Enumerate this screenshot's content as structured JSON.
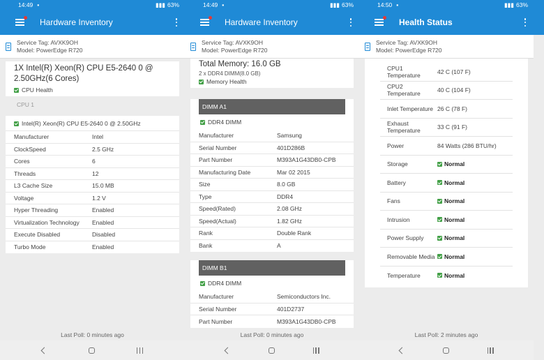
{
  "colors": {
    "accent": "#1f8ad6",
    "ok": "#43a047",
    "section_header": "#616161"
  },
  "icons": {
    "menu": "hamburger-menu-icon",
    "overflow": "kebab-menu-icon",
    "server": "server-icon",
    "check": "check-icon",
    "back": "back-icon",
    "home": "home-icon",
    "recent": "recent-apps-icon"
  },
  "screens": [
    {
      "status": {
        "time": "14:49",
        "battery": "63%"
      },
      "title": "Hardware Inventory",
      "device": {
        "service_tag": "Service Tag: AVXK9OH",
        "model": "Model: PowerEdge R720"
      },
      "summary": {
        "line1": "1X Intel(R) Xeon(R) CPU E5-2640 0 @",
        "line2": "2.50GHz(6 Cores)",
        "health": "CPU Health"
      },
      "section_label": "CPU 1",
      "cpu_name": "Intel(R) Xeon(R) CPU E5-2640 0 @ 2.50GHz",
      "specs": [
        {
          "key": "Manufacturer",
          "value": "Intel"
        },
        {
          "key": "ClockSpeed",
          "value": "2.5 GHz"
        },
        {
          "key": "Cores",
          "value": "6"
        },
        {
          "key": "Threads",
          "value": "12"
        },
        {
          "key": "L3 Cache Size",
          "value": "15.0 MB"
        },
        {
          "key": "Voltage",
          "value": "1.2 V"
        },
        {
          "key": "Hyper Threading",
          "value": "Enabled"
        },
        {
          "key": "Virtualization Technology",
          "value": "Enabled"
        },
        {
          "key": "Execute Disabled",
          "value": "Disabled"
        },
        {
          "key": "Turbo Mode",
          "value": "Enabled"
        }
      ],
      "last_poll": "Last Poll: 0 minutes ago"
    },
    {
      "status": {
        "time": "14:49",
        "battery": "63%"
      },
      "title": "Hardware Inventory",
      "device": {
        "service_tag": "Service Tag: AVXK9OH",
        "model": "Model: PowerEdge R720"
      },
      "summary": {
        "line1": "Total Memory: 16.0 GB",
        "line2": "2 x DDR4 DIMM(8.0 GB)",
        "health": "Memory Health"
      },
      "dimm_a1": {
        "header": "DIMM A1",
        "type_label": "DDR4 DIMM",
        "specs": [
          {
            "key": "Manufacturer",
            "value": "Samsung"
          },
          {
            "key": "Serial Number",
            "value": "401D286B"
          },
          {
            "key": "Part Number",
            "value": "M393A1G43DB0-CPB"
          },
          {
            "key": "Manufacturing Date",
            "value": "Mar 02 2015"
          },
          {
            "key": "Size",
            "value": "8.0 GB"
          },
          {
            "key": "Type",
            "value": "DDR4"
          },
          {
            "key": "Speed(Rated)",
            "value": "2.08 GHz"
          },
          {
            "key": "Speed(Actual)",
            "value": "1.82 GHz"
          },
          {
            "key": "Rank",
            "value": "Double Rank"
          },
          {
            "key": "Bank",
            "value": "A"
          }
        ]
      },
      "dimm_b1": {
        "header": "DIMM B1",
        "type_label": "DDR4 DIMM",
        "specs": [
          {
            "key": "Manufacturer",
            "value": "Semiconductors Inc."
          },
          {
            "key": "Serial Number",
            "value": "401D2737"
          },
          {
            "key": "Part Number",
            "value": "M393A1G43DB0-CPB"
          }
        ]
      },
      "last_poll": "Last Poll: 0 minutes ago"
    },
    {
      "status": {
        "time": "14:50",
        "battery": "63%"
      },
      "title": "Health Status",
      "device": {
        "service_tag": "Service Tag: AVXK9OH",
        "model": "Model: PowerEdge R720"
      },
      "rows": [
        {
          "key": "CPU1 Temperature",
          "value": "42 C (107 F)"
        },
        {
          "key": "CPU2 Temperature",
          "value": "40 C (104 F)"
        },
        {
          "key": "Inlet Temperature",
          "value": "26 C (78 F)"
        },
        {
          "key": "Exhaust Temperature",
          "value": "33 C (91 F)"
        },
        {
          "key": "Power",
          "value": "84 Watts (286 BTU/hr)"
        },
        {
          "key": "Storage",
          "value": "Normal"
        },
        {
          "key": "Battery",
          "value": "Normal"
        },
        {
          "key": "Fans",
          "value": "Normal"
        },
        {
          "key": "Intrusion",
          "value": "Normal"
        },
        {
          "key": "Power Supply",
          "value": "Normal"
        },
        {
          "key": "Removable Media",
          "value": "Normal"
        },
        {
          "key": "Temperature",
          "value": "Normal"
        }
      ],
      "last_poll": "Last Poll: 2 minutes ago"
    }
  ]
}
